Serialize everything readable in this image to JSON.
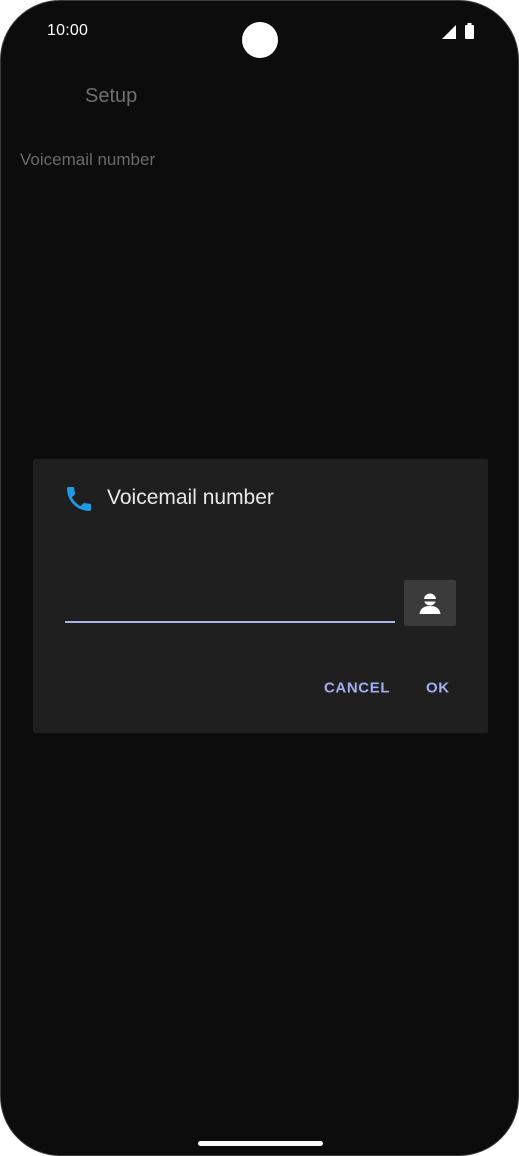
{
  "status_bar": {
    "time": "10:00",
    "icons": [
      "signal-icon",
      "battery-icon"
    ]
  },
  "background": {
    "title": "Setup",
    "item_label": "Voicemail number"
  },
  "dialog": {
    "icon": "phone-icon",
    "title": "Voicemail number",
    "input_value": "",
    "input_placeholder": "",
    "contact_icon": "contact-icon",
    "cancel_label": "CANCEL",
    "ok_label": "OK"
  },
  "colors": {
    "accent": "#a2aef1",
    "icon_blue": "#1e9be6",
    "dialog_bg": "#1f1f1f",
    "screen_bg": "#0c0c0c"
  }
}
